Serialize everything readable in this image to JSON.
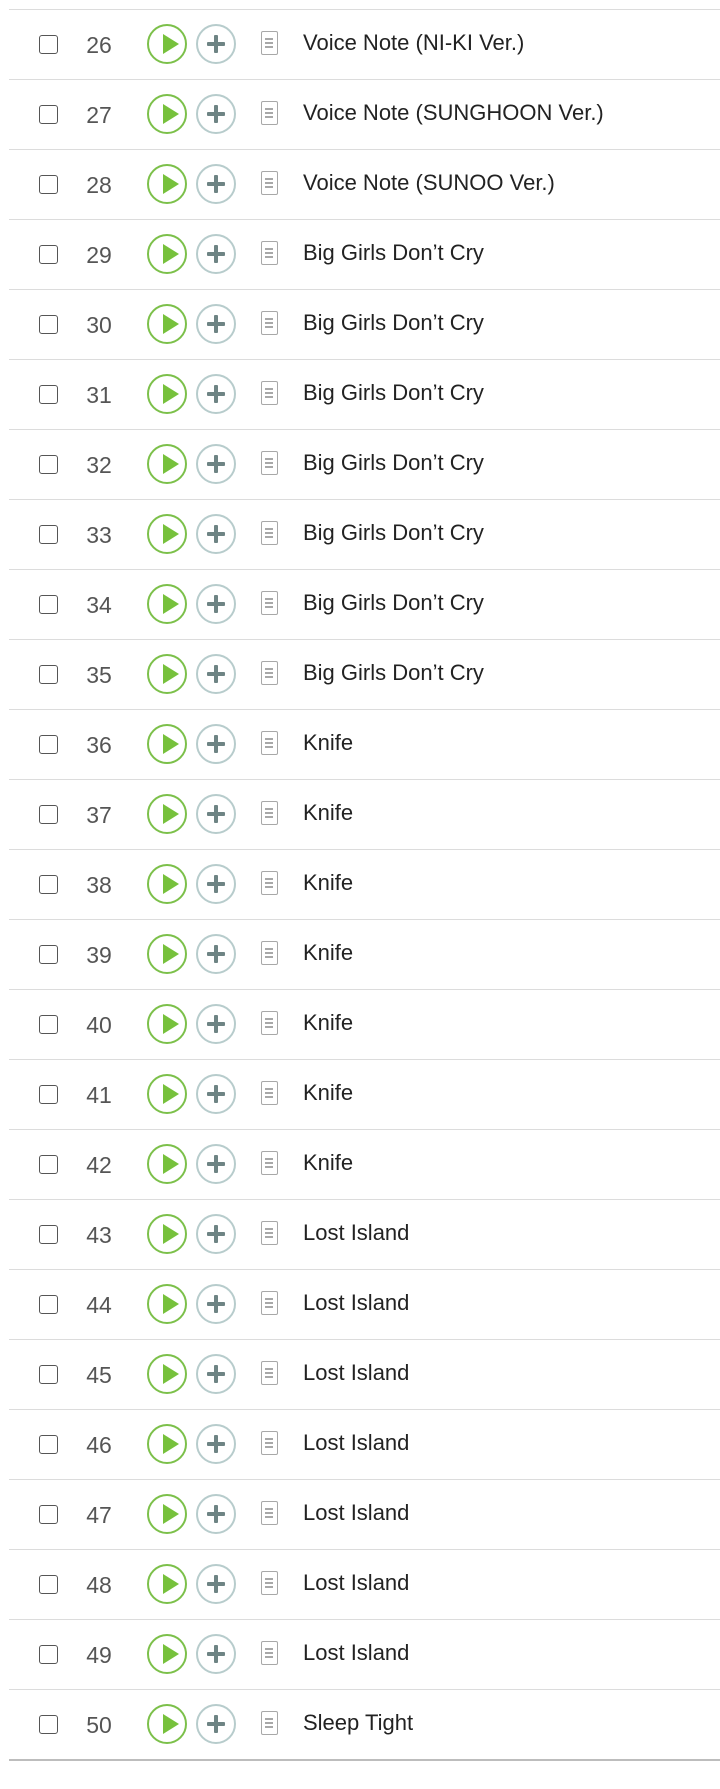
{
  "icons": {
    "checkbox": "checkbox-icon",
    "play": "play-icon",
    "add": "plus-icon",
    "lyrics": "document-icon"
  },
  "colors": {
    "play_accent": "#77c13c",
    "add_accent": "#6e8484",
    "row_divider": "#dcdcdc",
    "text": "#222222",
    "number": "#555555"
  },
  "tracks": [
    {
      "number": "26",
      "title": "Voice Note (NI-KI Ver.)"
    },
    {
      "number": "27",
      "title": "Voice Note (SUNGHOON Ver.)"
    },
    {
      "number": "28",
      "title": "Voice Note (SUNOO Ver.)"
    },
    {
      "number": "29",
      "title": "Big Girls Don’t Cry"
    },
    {
      "number": "30",
      "title": "Big Girls Don’t Cry"
    },
    {
      "number": "31",
      "title": "Big Girls Don’t Cry"
    },
    {
      "number": "32",
      "title": "Big Girls Don’t Cry"
    },
    {
      "number": "33",
      "title": "Big Girls Don’t Cry"
    },
    {
      "number": "34",
      "title": "Big Girls Don’t Cry"
    },
    {
      "number": "35",
      "title": "Big Girls Don’t Cry"
    },
    {
      "number": "36",
      "title": "Knife"
    },
    {
      "number": "37",
      "title": "Knife"
    },
    {
      "number": "38",
      "title": "Knife"
    },
    {
      "number": "39",
      "title": "Knife"
    },
    {
      "number": "40",
      "title": "Knife"
    },
    {
      "number": "41",
      "title": "Knife"
    },
    {
      "number": "42",
      "title": "Knife"
    },
    {
      "number": "43",
      "title": "Lost Island"
    },
    {
      "number": "44",
      "title": "Lost Island"
    },
    {
      "number": "45",
      "title": "Lost Island"
    },
    {
      "number": "46",
      "title": "Lost Island"
    },
    {
      "number": "47",
      "title": "Lost Island"
    },
    {
      "number": "48",
      "title": "Lost Island"
    },
    {
      "number": "49",
      "title": "Lost Island"
    },
    {
      "number": "50",
      "title": "Sleep Tight"
    }
  ]
}
